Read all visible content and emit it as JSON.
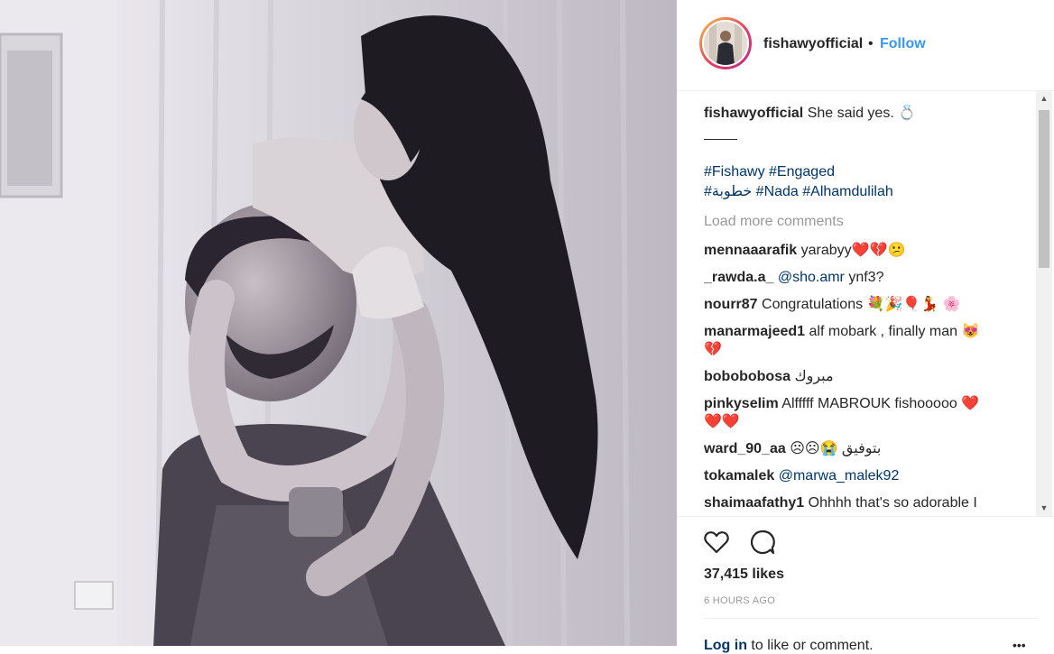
{
  "post": {
    "username": "fishawyofficial",
    "follow_dot": "•",
    "follow_label": "Follow",
    "caption_text": "She said yes. 💍",
    "caption_separator": "____",
    "hashtags_line1": "#Fishawy #Engaged",
    "hashtags_line2": "#خطوبة #Nada #Alhamdulilah",
    "load_more": "Load more comments",
    "comments": [
      {
        "user": "mennaaarafik",
        "text": "yarabyy❤️💔😕"
      },
      {
        "user": "_rawda.a_",
        "mention": "@sho.amr",
        "text": " ynf3?"
      },
      {
        "user": "nourr87",
        "text": "Congratulations 💐🎉🎈💃 🌸"
      },
      {
        "user": "manarmajeed1",
        "text": "alf mobark , finally man 😻",
        "text2": "💔"
      },
      {
        "user": "bobobobosa",
        "text": "مبروك"
      },
      {
        "user": "pinkyselim",
        "text": "Alfffff MABROUK fishooooo ❤️",
        "text2": "❤️❤️"
      },
      {
        "user": "ward_90_aa",
        "text": "☹☹😭 بتوفيق"
      },
      {
        "user": "tokamalek",
        "mention": "@marwa_malek92",
        "text": ""
      },
      {
        "user": "shaimaafathy1",
        "text": "Ohhhh that's so adorable I"
      }
    ],
    "likes": "37,415 likes",
    "time_ago": "6 HOURS AGO",
    "login_link": "Log in",
    "login_text": " to like or comment.",
    "more_label": "•••"
  },
  "icons": {
    "like": "heart-outline-icon",
    "comment": "comment-bubble-icon"
  },
  "colors": {
    "link": "#003569",
    "follow": "#3897f0",
    "muted": "#999999"
  }
}
